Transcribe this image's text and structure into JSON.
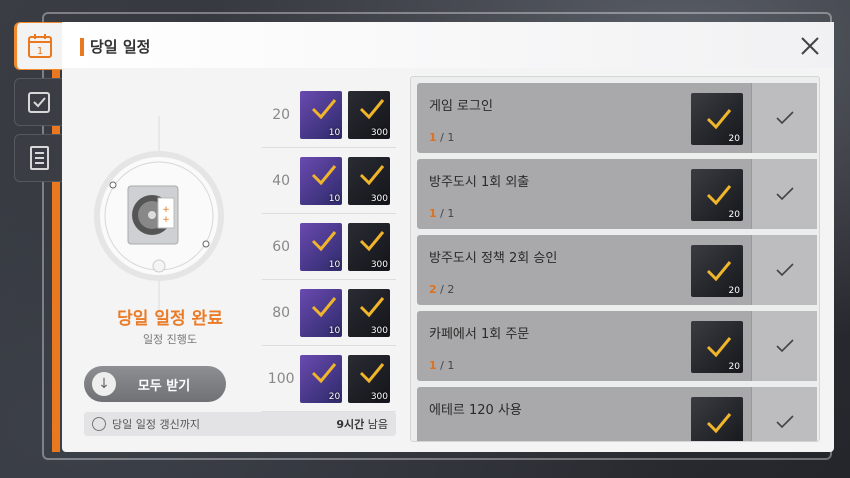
{
  "header": {
    "title": "당일 일정"
  },
  "side_tabs": [
    {
      "name": "calendar-icon",
      "label": "1",
      "active": true
    },
    {
      "name": "checkbox-icon",
      "active": false
    },
    {
      "name": "notebook-icon",
      "active": false
    }
  ],
  "summary": {
    "complete_text": "당일 일정 완료",
    "progress_label": "일정 진행도",
    "claim_all": "모두 받기",
    "refresh_label": "당일 일정 갱신까지",
    "refresh_hours": "9시간",
    "refresh_suffix": "남음"
  },
  "reward_tiers": [
    {
      "threshold": "20",
      "items": [
        {
          "type": "purple",
          "count": "10"
        },
        {
          "type": "dark",
          "count": "300"
        }
      ]
    },
    {
      "threshold": "40",
      "items": [
        {
          "type": "purple",
          "count": "10"
        },
        {
          "type": "dark",
          "count": "300"
        }
      ]
    },
    {
      "threshold": "60",
      "items": [
        {
          "type": "purple",
          "count": "10"
        },
        {
          "type": "dark",
          "count": "300"
        }
      ]
    },
    {
      "threshold": "80",
      "items": [
        {
          "type": "purple",
          "count": "10"
        },
        {
          "type": "dark",
          "count": "300"
        }
      ]
    },
    {
      "threshold": "100",
      "items": [
        {
          "type": "purple",
          "count": "20"
        },
        {
          "type": "dark",
          "count": "300"
        }
      ]
    }
  ],
  "missions": [
    {
      "title": "게임 로그인",
      "current": "1",
      "total": "1",
      "reward_count": "20"
    },
    {
      "title": "방주도시 1회 외출",
      "current": "1",
      "total": "1",
      "reward_count": "20"
    },
    {
      "title": "방주도시 정책 2회 승인",
      "current": "2",
      "total": "2",
      "reward_count": "20"
    },
    {
      "title": "카페에서 1회 주문",
      "current": "1",
      "total": "1",
      "reward_count": "20"
    },
    {
      "title": "에테르 120 사용",
      "current": "",
      "total": "",
      "reward_count": ""
    }
  ],
  "colors": {
    "accent": "#e9781e",
    "check": "#f0b52a"
  }
}
